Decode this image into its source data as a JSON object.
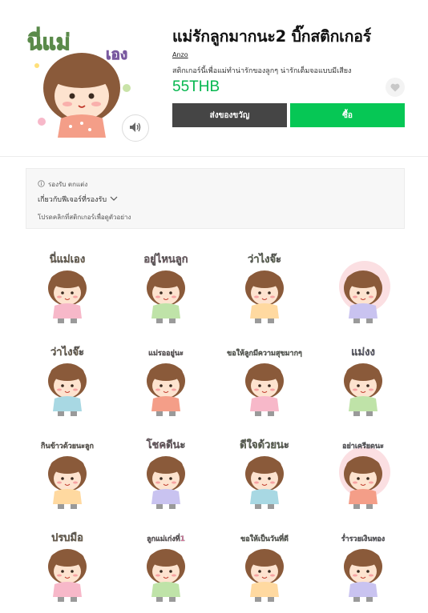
{
  "product": {
    "title": "แม่รักลูกมากนะ2 บิ๊กสติกเกอร์",
    "author": "Anzo",
    "description": "สติกเกอร์นี้เพื่อแม่ทำน่ารักของลูกๆ น่ารักเต็มจอแบบมีเสียง",
    "price": "55THB",
    "main_sticker_text": "นี่แม่เอง"
  },
  "buttons": {
    "gift_label": "ส่งของขวัญ",
    "buy_label": "ซื้อ"
  },
  "info": {
    "support_label": "รองรับ ตกแต่ง",
    "features_label": "เกี่ยวกับฟีเจอร์ที่รองรับ",
    "preview_hint": "โปรดคลิกที่สติกเกอร์เพื่อดูตัวอย่าง"
  },
  "icons": {
    "sound": "speaker-icon",
    "favorite": "heart-icon",
    "info": "info-circle-icon",
    "expand": "chevron-down-icon"
  },
  "colors": {
    "price_green": "#06b74f",
    "buy_green": "#06c755",
    "gift_dark": "#454545"
  },
  "stickers": [
    {
      "caption": "นี่แม่เอง"
    },
    {
      "caption": "อยู่ไหนลูก"
    },
    {
      "caption": "ว่าไงจ๊ะ"
    },
    {
      "caption": ""
    },
    {
      "caption": "ว่าไงจ๊ะ"
    },
    {
      "caption": "แม่รออยู่นะ"
    },
    {
      "caption": "ขอให้ลูกมีความสุขมากๆ"
    },
    {
      "caption": "แม่งง"
    },
    {
      "caption": "กินข้าวด้วยนะลูก"
    },
    {
      "caption": "โชคดีนะ"
    },
    {
      "caption": "ดีใจด้วยนะ"
    },
    {
      "caption": "อย่าเครียดนะ"
    },
    {
      "caption": "ปรบมือ"
    },
    {
      "caption": "ลูกแม่เก่งที่1"
    },
    {
      "caption": "ขอให้เป็นวันที่ดี"
    },
    {
      "caption": "ร่ำรวยเงินทอง"
    }
  ]
}
